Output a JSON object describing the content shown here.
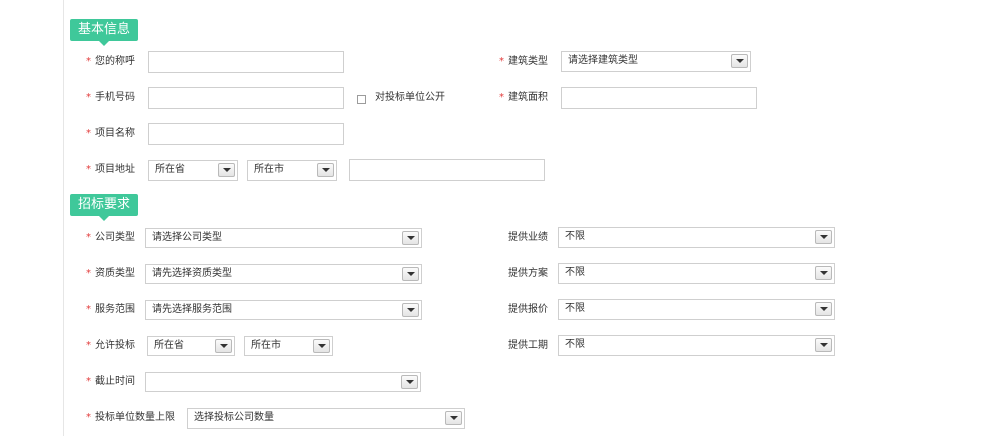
{
  "sections": {
    "basic": "基本信息",
    "requirements": "招标要求"
  },
  "basic": {
    "nickname_label": "您的称呼",
    "building_type_label": "建筑类型",
    "building_type_value": "请选择建筑类型",
    "phone_label": "手机号码",
    "public_checkbox_label": "对投标单位公开",
    "building_area_label": "建筑面积",
    "project_name_label": "项目名称",
    "project_address_label": "项目地址",
    "province_value": "所在省",
    "city_value": "所在市"
  },
  "requirements": {
    "company_type_label": "公司类型",
    "company_type_value": "请选择公司类型",
    "qualification_label": "资质类型",
    "qualification_value": "请先选择资质类型",
    "service_scope_label": "服务范围",
    "service_scope_value": "请先选择服务范围",
    "allowed_bid_label": "允许投标",
    "province_value": "所在省",
    "city_value": "所在市",
    "deadline_label": "截止时间",
    "bidder_limit_label": "投标单位数量上限",
    "bidder_limit_value": "选择投标公司数量",
    "perf_label": "提供业绩",
    "perf_value": "不限",
    "plan_label": "提供方案",
    "plan_value": "不限",
    "quote_label": "提供报价",
    "quote_value": "不限",
    "period_label": "提供工期",
    "period_value": "不限"
  },
  "required_mark": "*"
}
